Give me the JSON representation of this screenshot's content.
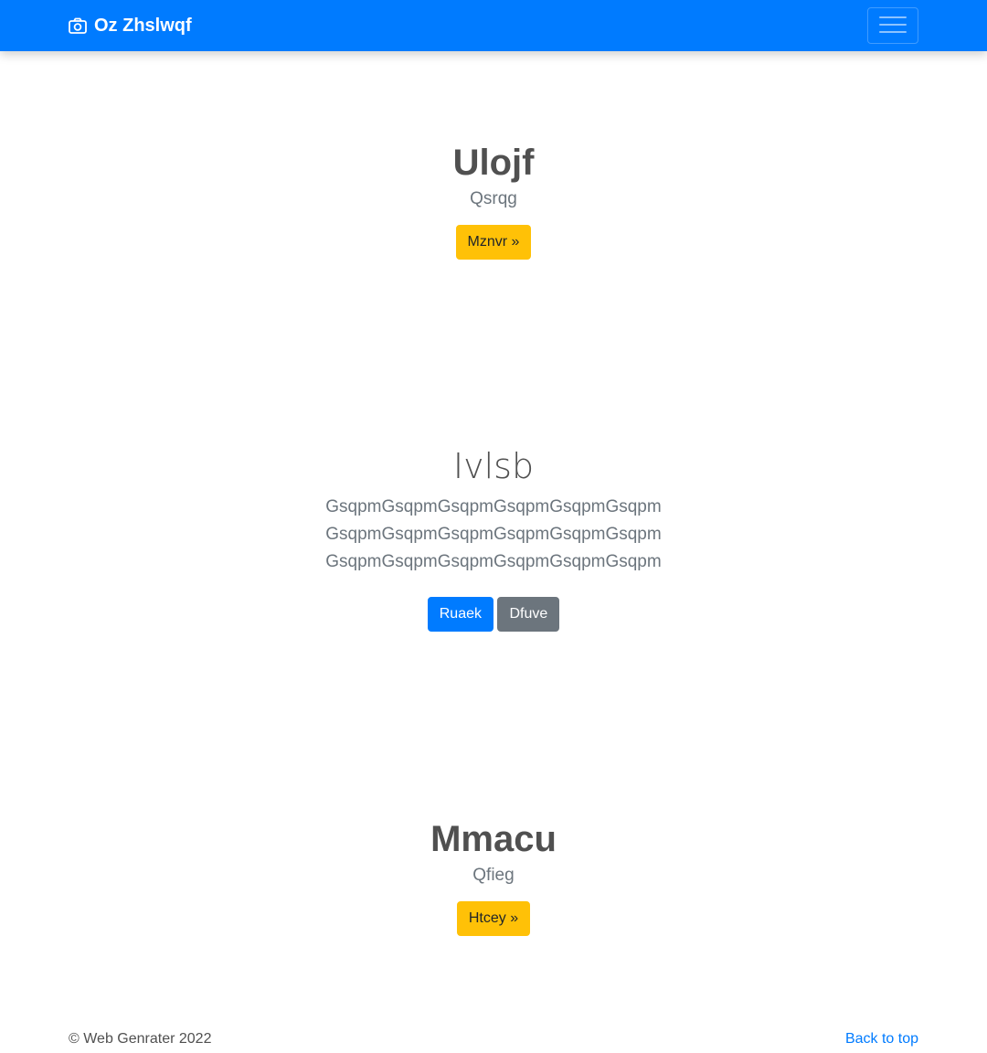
{
  "navbar": {
    "brand_text": "Oz Zhslwqf",
    "brand_icon": "camera-icon",
    "toggler_icon": "hamburger-menu-icon",
    "background_color": "#007bff"
  },
  "sections": [
    {
      "heading": "Ulojf",
      "subheading": "Qsrqg",
      "button_label": "Mznvr »",
      "button_color": "#ffc107"
    },
    {
      "heading": "Ivlsb",
      "lead": "GsqpmGsqpmGsqpmGsqpmGsqpmGsqpmGsqpmGsqpmGsqpmGsqpmGsqpmGsqpmGsqpmGsqpmGsqpmGsqpmGsqpmGsqpm",
      "primary_button_label": "Ruaek",
      "secondary_button_label": "Dfuve",
      "primary_color": "#007bff",
      "secondary_color": "#6c757d"
    },
    {
      "heading": "Mmacu",
      "subheading": "Qfieg",
      "button_label": "Htcey »",
      "button_color": "#ffc107"
    }
  ],
  "footer": {
    "copyright": "© Web Genrater 2022",
    "back_to_top": "Back to top"
  }
}
